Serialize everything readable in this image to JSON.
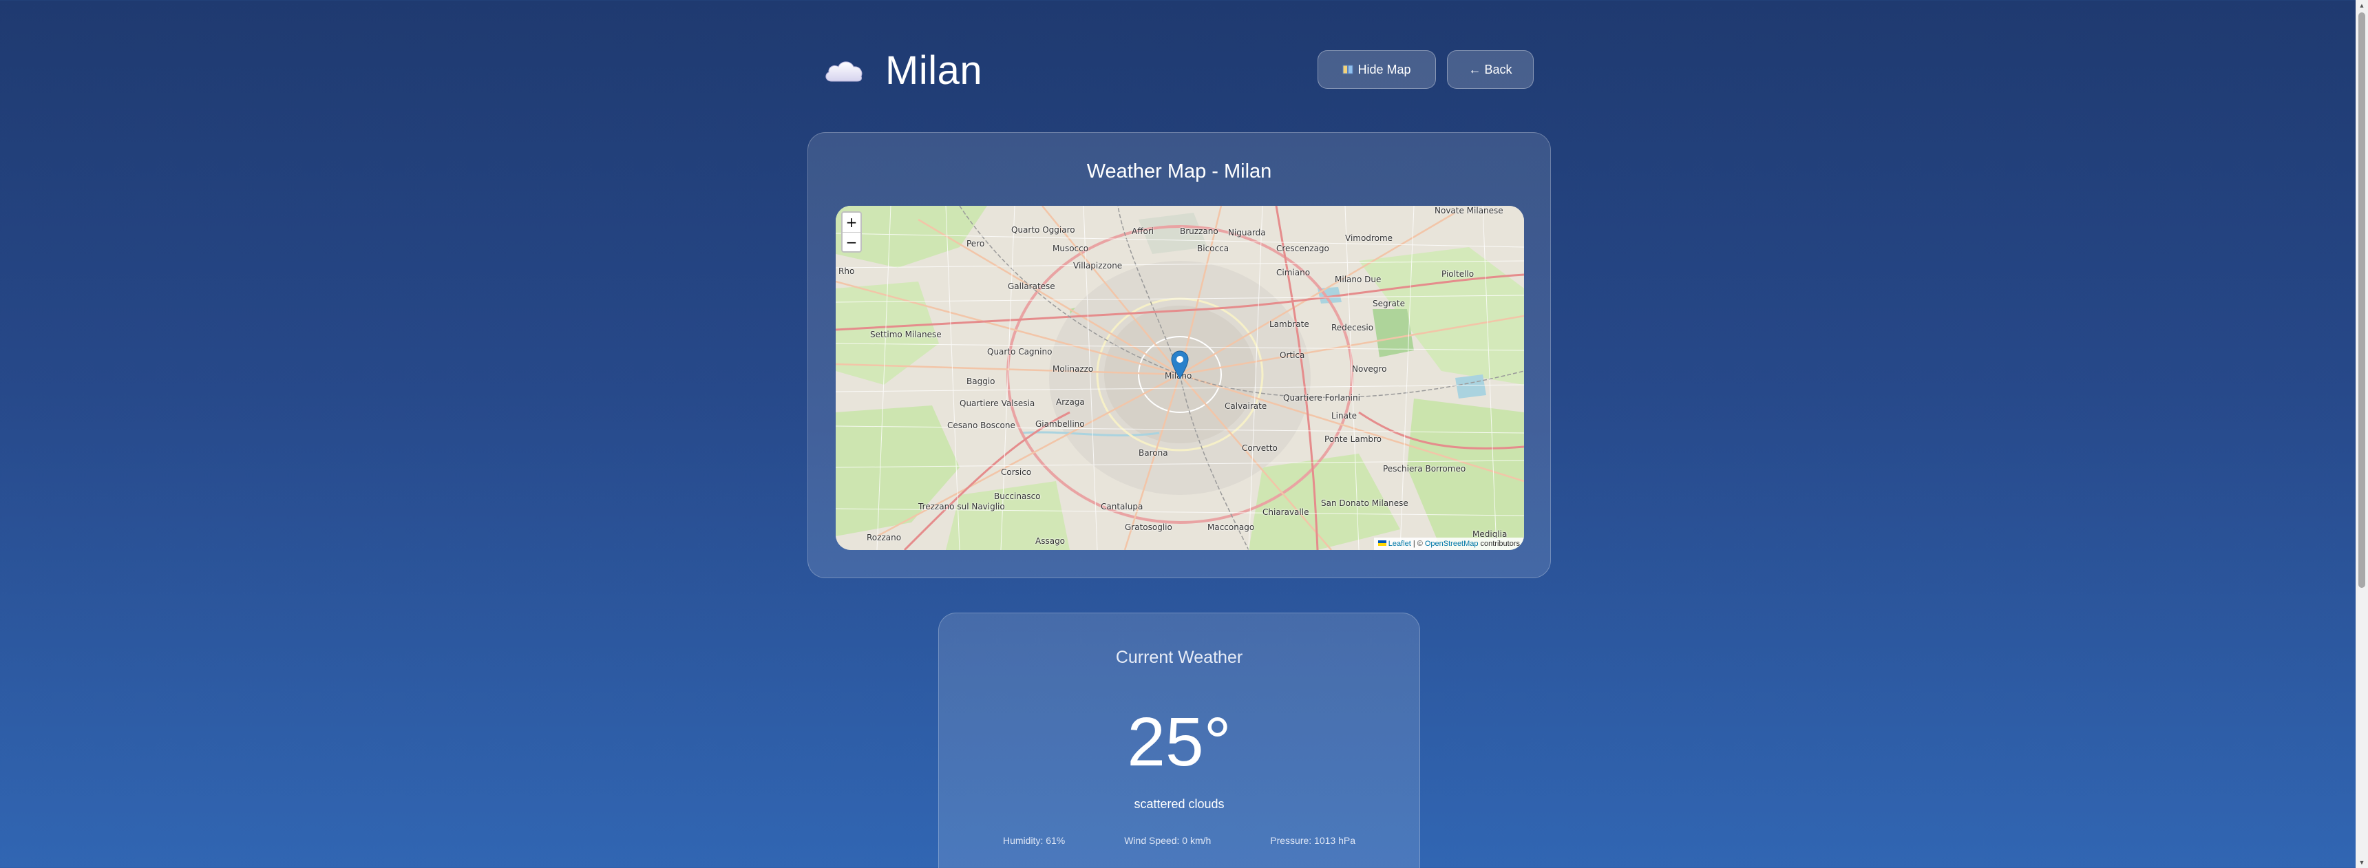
{
  "header": {
    "city": "Milan",
    "weather_icon": "cloud-icon",
    "hide_map_label": "Hide Map",
    "back_label": "← Back"
  },
  "map_card": {
    "title": "Weather Map - Milan",
    "zoom_in": "+",
    "zoom_out": "−",
    "attribution": {
      "leaflet": "Leaflet",
      "sep": "| ©",
      "osm": "OpenStreetMap",
      "tail": "contributors"
    },
    "labels": [
      "Novate Milanese",
      "Quarto Oggiaro",
      "Affori",
      "Bruzzano",
      "Niguarda",
      "Vimodrome",
      "Bicocca",
      "Pero",
      "Musocco",
      "Villapizzone",
      "Crescenzago",
      "Cimiano",
      "Milano Due",
      "Pioltello",
      "Rho",
      "Settimo Milanese",
      "Gallaratese",
      "Segrate",
      "Quarto Cagnino",
      "Lambrate",
      "Redecesio",
      "Baggio",
      "Molinazzo",
      "Milano",
      "Ortica",
      "Novegro",
      "Quartiere Valsesia",
      "Arzaga",
      "Calvairate",
      "Quartiere Forlanini",
      "Linate",
      "Cesano Boscone",
      "Giambellino",
      "Corvetto",
      "Ponte Lambro",
      "Corsico",
      "Barona",
      "Chiaravalle",
      "San Donato Milanese",
      "Buccinasco",
      "Cantalupa",
      "Gratosoglio",
      "Macconago",
      "Peschiera Borromeo",
      "Trezzano sul Naviglio",
      "Assago",
      "Rozzano",
      "Mediglia"
    ],
    "colors": {
      "accent_blue": "#2a81cb"
    }
  },
  "weather": {
    "title": "Current Weather",
    "temperature": "25°",
    "description": "scattered clouds",
    "humidity": "Humidity: 61%",
    "wind": "Wind Speed: 0 km/h",
    "pressure": "Pressure: 1013 hPa"
  }
}
